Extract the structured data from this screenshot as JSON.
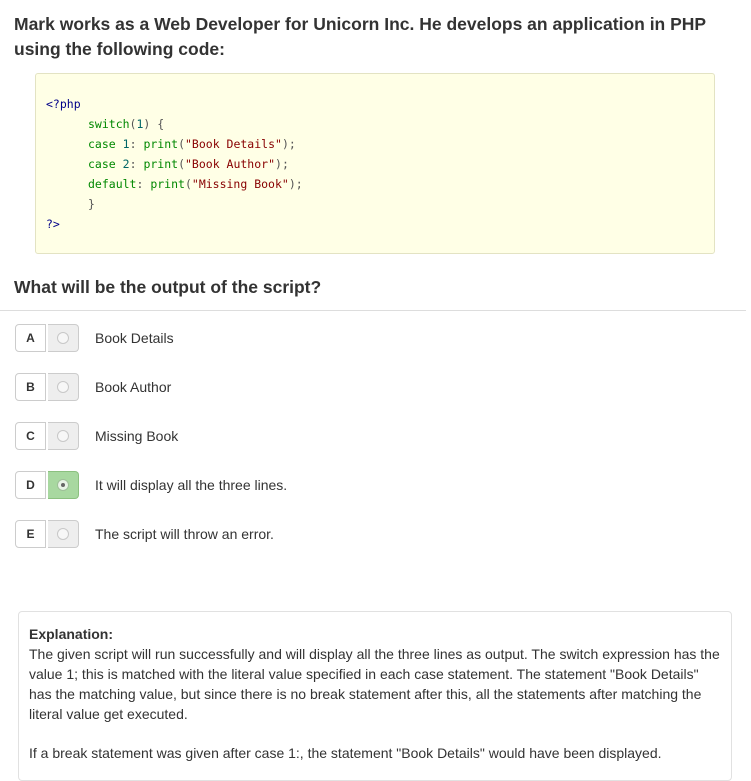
{
  "question": {
    "text": "Mark works as a Web Developer for Unicorn Inc. He develops an application in PHP using the following code:"
  },
  "code": {
    "lines": [
      [
        {
          "t": "<?php",
          "c": "tag"
        }
      ],
      [
        {
          "t": "switch",
          "c": "kw"
        },
        {
          "t": "(",
          "c": "punc"
        },
        {
          "t": "1",
          "c": "num"
        },
        {
          "t": ")",
          "c": "punc"
        },
        {
          "t": " {",
          "c": "punc"
        }
      ],
      [
        {
          "t": "case",
          "c": "kw"
        },
        {
          "t": " ",
          "c": "punc"
        },
        {
          "t": "1",
          "c": "num"
        },
        {
          "t": ": ",
          "c": "punc"
        },
        {
          "t": "print",
          "c": "kw"
        },
        {
          "t": "(",
          "c": "punc"
        },
        {
          "t": "\"Book Details\"",
          "c": "str"
        },
        {
          "t": ");",
          "c": "punc"
        }
      ],
      [
        {
          "t": "case",
          "c": "kw"
        },
        {
          "t": " ",
          "c": "punc"
        },
        {
          "t": "2",
          "c": "num"
        },
        {
          "t": ": ",
          "c": "punc"
        },
        {
          "t": "print",
          "c": "kw"
        },
        {
          "t": "(",
          "c": "punc"
        },
        {
          "t": "\"Book Author\"",
          "c": "str"
        },
        {
          "t": ");",
          "c": "punc"
        }
      ],
      [
        {
          "t": "default",
          "c": "kw"
        },
        {
          "t": ": ",
          "c": "punc"
        },
        {
          "t": "print",
          "c": "kw"
        },
        {
          "t": "(",
          "c": "punc"
        },
        {
          "t": "\"Missing Book\"",
          "c": "str"
        },
        {
          "t": ");",
          "c": "punc"
        }
      ],
      [
        {
          "t": "}",
          "c": "punc"
        }
      ],
      [
        {
          "t": "?>",
          "c": "tag"
        }
      ]
    ]
  },
  "subquestion": {
    "text": "What will be the output of the script?"
  },
  "options": [
    {
      "letter": "A",
      "text": "Book Details",
      "selected": false
    },
    {
      "letter": "B",
      "text": "Book Author",
      "selected": false
    },
    {
      "letter": "C",
      "text": "Missing Book",
      "selected": false
    },
    {
      "letter": "D",
      "text": "It will display all the three lines.",
      "selected": true
    },
    {
      "letter": "E",
      "text": "The script will throw an error.",
      "selected": false
    }
  ],
  "explanation": {
    "title": "Explanation:",
    "paragraph1": "The given script will run successfully and will display all the three lines as output. The switch expression has the value 1; this is matched with the literal value specified in each case statement. The statement \"Book Details\" has the matching value, but since there is no break statement after this, all the statements after matching the literal value get executed.",
    "paragraph2": "If a break statement was given after case 1:, the statement \"Book Details\" would have been displayed."
  },
  "colors": {
    "code_background": "#ffffe6",
    "selected_option": "#a8d8a0"
  }
}
